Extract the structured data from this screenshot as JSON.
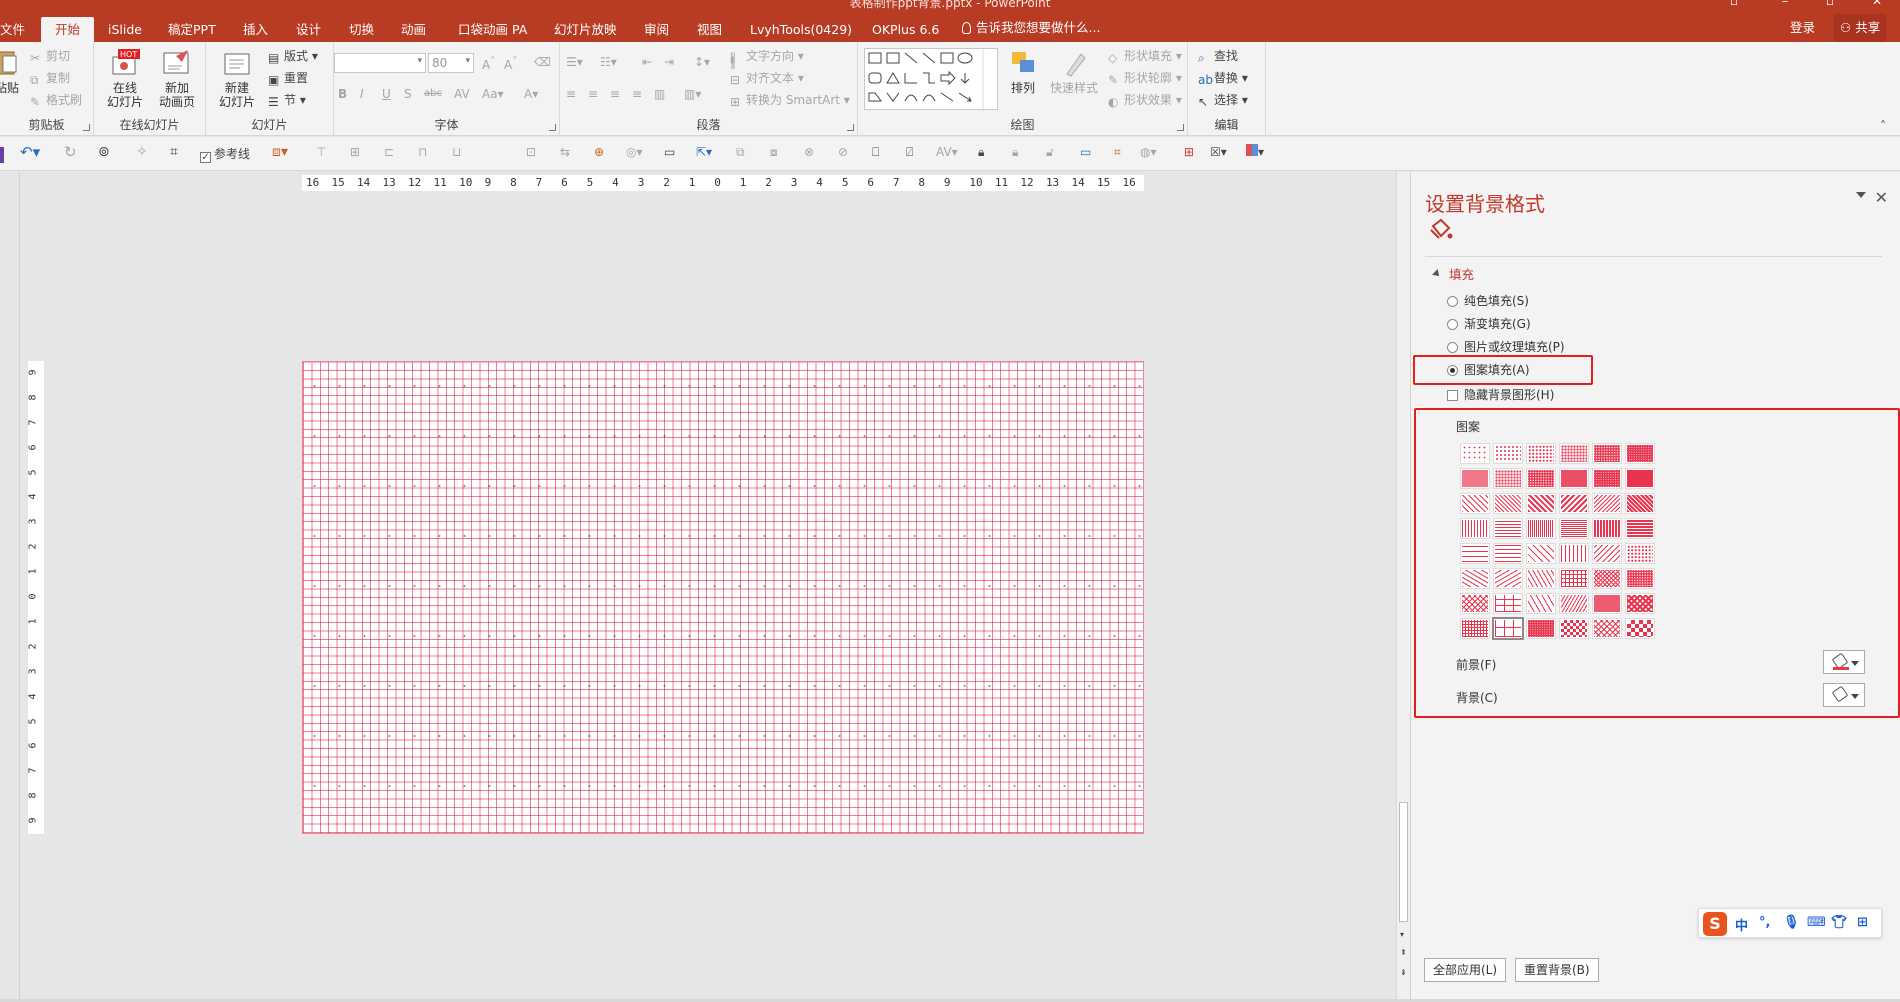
{
  "window": {
    "title": "表格制作ppt背景.pptx - PowerPoint"
  },
  "tabs": [
    "文件",
    "开始",
    "iSlide",
    "稿定PPT",
    "插入",
    "设计",
    "切换",
    "动画",
    "口袋动画 PA",
    "幻灯片放映",
    "审阅",
    "视图",
    "LvyhTools(0429)",
    "OKPlus 6.6"
  ],
  "tell_me": "告诉我您想要做什么...",
  "account": {
    "login": "登录",
    "share": "共享"
  },
  "ribbon": {
    "clipboard": {
      "label": "剪贴板",
      "paste": "粘贴",
      "cut": "剪切",
      "copy": "复制",
      "format_painter": "格式刷"
    },
    "online_slides": {
      "label": "在线幻灯片",
      "online": "在线\n幻灯片",
      "new_anim": "新加\n动画页",
      "hot": "HOT"
    },
    "slides": {
      "label": "幻灯片",
      "new_slide": "新建\n幻灯片",
      "layout": "版式",
      "reset": "重置",
      "section": "节"
    },
    "font": {
      "label": "字体",
      "size": "80"
    },
    "paragraph": {
      "label": "段落",
      "text_dir": "文字方向",
      "align_text": "对齐文本",
      "smartart": "转换为 SmartArt"
    },
    "drawing": {
      "label": "绘图",
      "arrange": "排列",
      "quick_style": "快速样式",
      "shape_fill": "形状填充",
      "shape_outline": "形状轮廓",
      "shape_effect": "形状效果"
    },
    "editing": {
      "label": "编辑",
      "find": "查找",
      "replace": "替换",
      "select": "选择"
    }
  },
  "toolbar2": {
    "guides": "参考线"
  },
  "ruler": {
    "h": [
      "16",
      "15",
      "14",
      "13",
      "12",
      "11",
      "10",
      "9",
      "8",
      "7",
      "6",
      "5",
      "4",
      "3",
      "2",
      "1",
      "0",
      "1",
      "2",
      "3",
      "4",
      "5",
      "6",
      "7",
      "8",
      "9",
      "10",
      "11",
      "12",
      "13",
      "14",
      "15",
      "16"
    ],
    "v": [
      "9",
      "8",
      "7",
      "6",
      "5",
      "4",
      "3",
      "2",
      "1",
      "0",
      "1",
      "2",
      "3",
      "4",
      "5",
      "6",
      "7",
      "8",
      "9"
    ]
  },
  "pane": {
    "title": "设置背景格式",
    "section": "填充",
    "options": [
      {
        "label": "纯色填充(S)",
        "selected": false
      },
      {
        "label": "渐变填充(G)",
        "selected": false
      },
      {
        "label": "图片或纹理填充(P)",
        "selected": false
      },
      {
        "label": "图案填充(A)",
        "selected": true
      }
    ],
    "hide_bg": "隐藏背景图形(H)",
    "pattern_label": "图案",
    "foreground": "前景(F)",
    "background": "背景(C)",
    "apply_all": "全部应用(L)",
    "reset_bg": "重置背景(B)",
    "foreground_color": "#e8344e"
  },
  "ime": {
    "logo": "S",
    "mode": "中"
  }
}
